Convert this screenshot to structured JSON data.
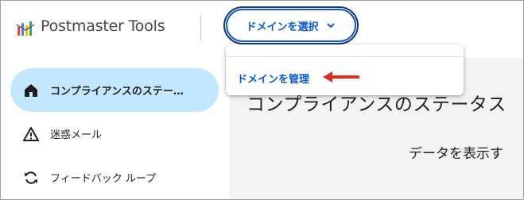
{
  "header": {
    "app_title": "Postmaster Tools",
    "domain_button_label": "ドメインを選択"
  },
  "dropdown": {
    "items": [
      {
        "label": "ドメインを管理",
        "highlighted_by": "red-arrow-icon"
      }
    ]
  },
  "sidebar": {
    "items": [
      {
        "label": "コンプライアンスのステー…",
        "icon": "home-icon",
        "active": true
      },
      {
        "label": "迷惑メール",
        "icon": "warning-icon",
        "active": false
      },
      {
        "label": "フィードバック ループ",
        "icon": "sync-icon",
        "active": false
      }
    ]
  },
  "main": {
    "section_title": "コンプライアンスのステータス",
    "data_text": "データを表示す"
  },
  "colors": {
    "accent": "#0b57d0",
    "active_nav": "#c2e7ff",
    "arrow": "#d93025",
    "main_background": "#f3f3f3"
  }
}
